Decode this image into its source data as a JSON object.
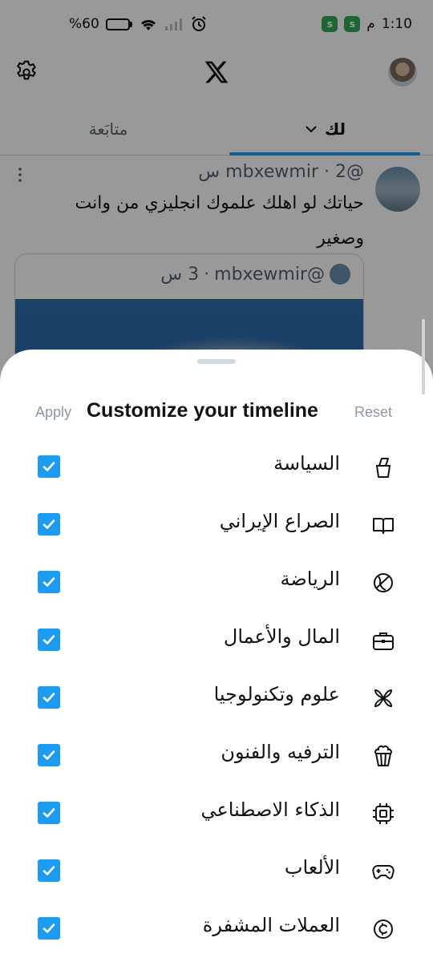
{
  "status_bar": {
    "time": "1:10",
    "time_suffix": "م",
    "battery_text": "%60",
    "battery_level": 0.6,
    "icons": [
      "app-badge-icon",
      "app-badge-icon",
      "alarm-icon",
      "signal-icon",
      "wifi-icon",
      "battery-icon"
    ]
  },
  "top_bar": {
    "settings_icon": "gear-icon",
    "logo_icon": "x-logo-icon",
    "avatar": "profile-avatar"
  },
  "tabs": {
    "for_you": "لك",
    "following": "متابَعة"
  },
  "tweet": {
    "handle": "@mbxewmir",
    "time": "2 س",
    "separator": "·",
    "text": "حياتك لو اهلك علموك انجليزي من وانت وصغير",
    "quote": {
      "handle": "@mbxewmir",
      "time": "3 س",
      "separator": "·"
    }
  },
  "sheet": {
    "apply_label": "Apply",
    "title": "Customize your timeline",
    "reset_label": "Reset",
    "topics": [
      {
        "label": "السياسة",
        "icon": "ballot-box-icon",
        "checked": true
      },
      {
        "label": "الصراع الإيراني",
        "icon": "book-icon",
        "checked": true
      },
      {
        "label": "الرياضة",
        "icon": "ball-icon",
        "checked": true
      },
      {
        "label": "المال والأعمال",
        "icon": "briefcase-icon",
        "checked": true
      },
      {
        "label": "علوم وتكنولوجيا",
        "icon": "atom-icon",
        "checked": true
      },
      {
        "label": "الترفيه والفنون",
        "icon": "popcorn-icon",
        "checked": true
      },
      {
        "label": "الذكاء الاصطناعي",
        "icon": "chip-icon",
        "checked": true
      },
      {
        "label": "الألعاب",
        "icon": "gamepad-icon",
        "checked": true
      },
      {
        "label": "العملات المشفرة",
        "icon": "crypto-coin-icon",
        "checked": true
      }
    ]
  },
  "colors": {
    "accent": "#1d9bf0",
    "text": "#0f1419",
    "muted": "#536471",
    "overlay": "rgba(0,0,0,0.4)"
  }
}
